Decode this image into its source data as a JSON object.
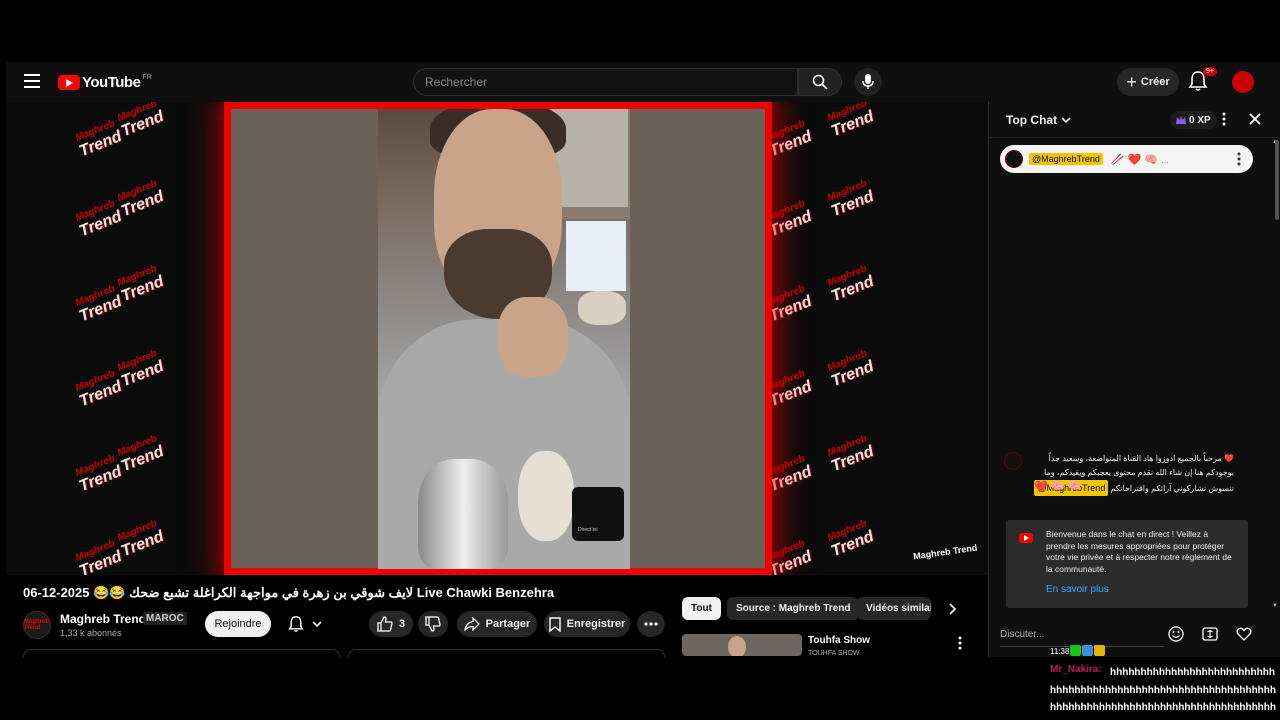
{
  "header": {
    "brand": "YouTube",
    "region": "FR",
    "search_placeholder": "Rechercher",
    "create_label": "Créer",
    "notification_badge": "9+"
  },
  "player": {
    "watermark_top": "Maghreb",
    "watermark_bottom": "Trend",
    "corner_logo": "Maghreb Trend",
    "phone_text": "Direct ini"
  },
  "video": {
    "title": "06-12-2025 😂😂 لايف شوقي بن زهرة في مواجهة الكراغلة تشبع ضحك Live Chawki Benzehra",
    "channel_name": "Maghreb Trend",
    "channel_badge": "MAROC",
    "subscribers": "1,33 k abonnés",
    "avatar_text": "Maghreb Trend",
    "join_label": "Rejoindre",
    "like_count": "3",
    "share_label": "Partager",
    "save_label": "Enregistrer"
  },
  "filters": {
    "chips": [
      "Tout",
      "Source : Maghreb Trend",
      "Vidéos similai"
    ]
  },
  "recommendation": {
    "title": "Touhfa Show",
    "channel": "TOUHFA SHOW"
  },
  "chat": {
    "title": "Top Chat",
    "xp": "0 XP",
    "pinned_mention": "@MaghrebTrend",
    "message_mention": "@MaghrebTrend",
    "message_text": "مرحباً بالجميع ادوزوا هاد القناة المتواضعة، وسعيد جداً بوجودكم هنا إن شاء الله نقدم محتوى يعجبكم ويفيدكم، وما تنسوش تشاركوني آرائكم واقتراحاتكم",
    "notice_text": "Bienvenue dans le chat en direct ! Veillez à prendre les mesures appropriées pour protéger votre vie privée et à respecter notre règlement de la communauté.",
    "notice_link": "En savoir plus",
    "input_placeholder": "Discuter..."
  },
  "overlay": {
    "time": "11:38",
    "username": "Mr_Nakira:",
    "message": "hhhhhhhhhhhhhhhhhhhhhhhhhhhhhhhhhhhhhhhhhhhhhhhhhhhhhhhhhhhhhhhhhhhhhhhhhhhhhhhhhhhhhhhhhhhhhhhhhhhhhhhhhhhhhhhhhh"
  },
  "colors": {
    "accent_red": "#ff0000",
    "frame_red": "#e00000",
    "mention_yellow": "#f4c400",
    "link_blue": "#3ea6ff"
  }
}
